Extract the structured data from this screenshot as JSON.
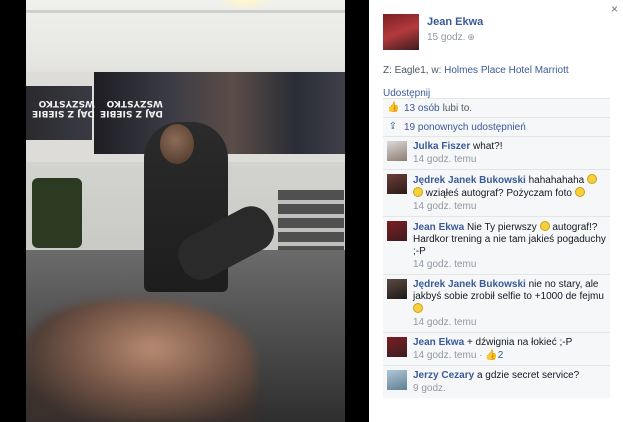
{
  "photo": {
    "banner_left_text": "DAJ Z SIEBIE\nWSZYSTKO",
    "banner_right_text": "DAJ Z SIEBIE\nWSZYSTKO"
  },
  "panel": {
    "close_label": "×",
    "author": {
      "name": "Jean Ekwa",
      "time": "15 godz.",
      "privacy_icon": "globe-icon"
    },
    "with_prefix": "Z: Eagle1, w: ",
    "place": "Holmes Place Hotel Marriott",
    "share_label": "Udostępnij",
    "likes": {
      "icon": "thumbs-up-icon",
      "link": "13 osób",
      "rest": "lubi to."
    },
    "reshares": {
      "icon": "share-icon",
      "link": "19 ponownych udostępnień"
    },
    "comments": [
      {
        "name": "Julka Fiszer",
        "text": "what?!",
        "time": "14 godz. temu"
      },
      {
        "name": "Jędrek Janek Bukowski",
        "text": "hahahahaha",
        "text2": "wziąłeś autograf? Pożyczam foto",
        "time": "14 godz. temu"
      },
      {
        "name": "Jean Ekwa",
        "text": "Nie Ty pierwszy",
        "text2": "autograf!? Hardkor trening a nie tam jakieś pogaduchy ;-P",
        "time": "14 godz. temu"
      },
      {
        "name": "Jędrek Janek Bukowski",
        "text": "nie no stary, ale jakbyś sobie zrobił selfie to +1000 de fejmu",
        "time": "14 godz. temu"
      },
      {
        "name": "Jean Ekwa",
        "text": "+ dźwignia na łokieć ;-P",
        "time": "14 godz. temu",
        "likes": "2"
      },
      {
        "name": "Jerzy Cezary",
        "text": "a gdzie secret service?",
        "time": "9 godz."
      }
    ]
  }
}
